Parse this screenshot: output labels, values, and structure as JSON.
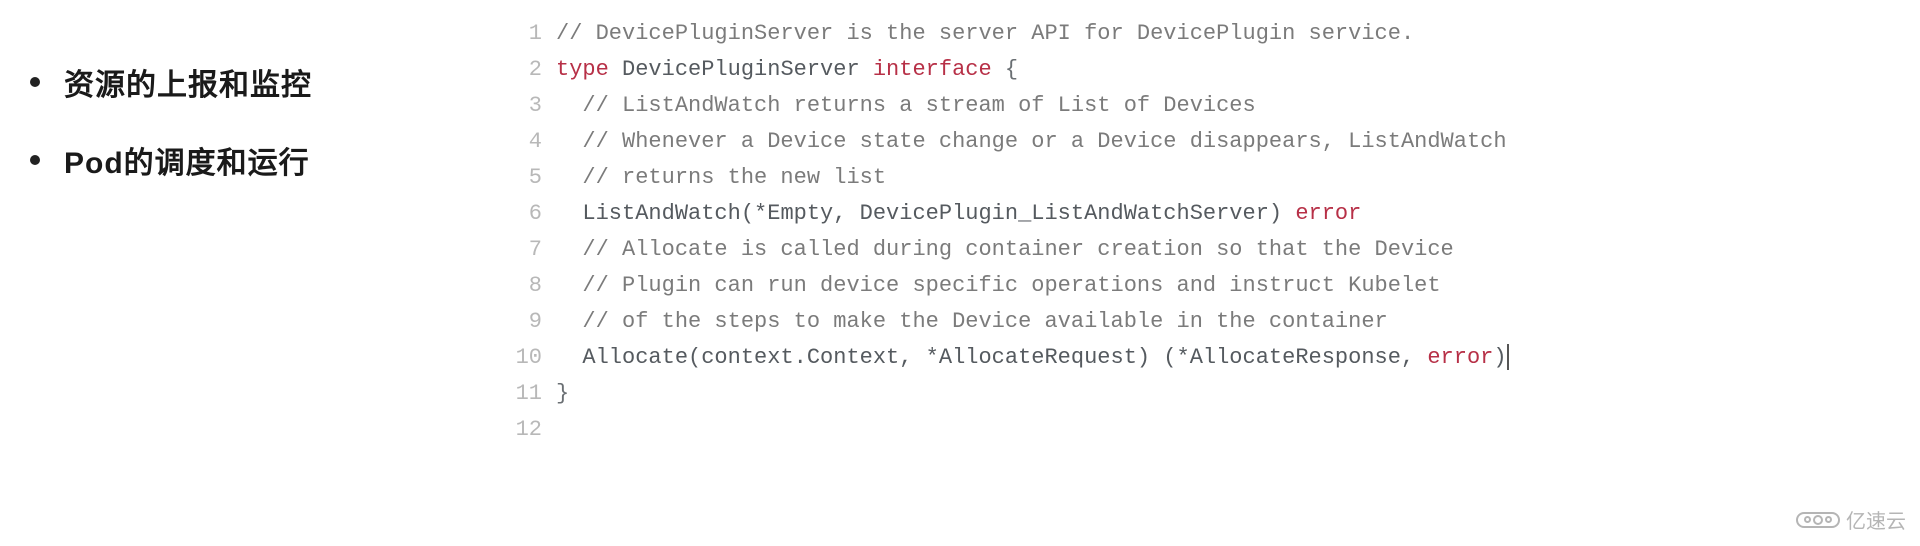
{
  "bullets": [
    "资源的上报和监控",
    "Pod的调度和运行"
  ],
  "code": {
    "lines": [
      {
        "n": 1,
        "segments": [
          {
            "t": "// DevicePluginServer is the server API for DevicePlugin service.",
            "c": "code"
          }
        ]
      },
      {
        "n": 2,
        "segments": [
          {
            "t": "type",
            "c": "tok-kw"
          },
          {
            "t": " ",
            "c": "code"
          },
          {
            "t": "DevicePluginServer",
            "c": "tok-id"
          },
          {
            "t": " ",
            "c": "code"
          },
          {
            "t": "interface",
            "c": "tok-kw"
          },
          {
            "t": " ",
            "c": "code"
          },
          {
            "t": "{",
            "c": "tok-punc"
          }
        ]
      },
      {
        "n": 3,
        "segments": [
          {
            "t": "  // ListAndWatch returns a stream of List of Devices",
            "c": "code"
          }
        ]
      },
      {
        "n": 4,
        "segments": [
          {
            "t": "  // Whenever a Device state change or a Device disappears, ListAndWatch",
            "c": "code"
          }
        ]
      },
      {
        "n": 5,
        "segments": [
          {
            "t": "  // returns the new list",
            "c": "code"
          }
        ]
      },
      {
        "n": 6,
        "segments": [
          {
            "t": "  ",
            "c": "code"
          },
          {
            "t": "ListAndWatch(*Empty, DevicePlugin_ListAndWatchServer)",
            "c": "tok-id"
          },
          {
            "t": " ",
            "c": "code"
          },
          {
            "t": "error",
            "c": "tok-err"
          }
        ]
      },
      {
        "n": 7,
        "segments": [
          {
            "t": "  // Allocate is called during container creation so that the Device",
            "c": "code"
          }
        ]
      },
      {
        "n": 8,
        "segments": [
          {
            "t": "  // Plugin can run device specific operations and instruct Kubelet",
            "c": "code"
          }
        ]
      },
      {
        "n": 9,
        "segments": [
          {
            "t": "  // of the steps to make the Device available in the container",
            "c": "code"
          }
        ]
      },
      {
        "n": 10,
        "segments": [
          {
            "t": "  ",
            "c": "code"
          },
          {
            "t": "Allocate(context.Context, *AllocateRequest) (*AllocateResponse,",
            "c": "tok-id"
          },
          {
            "t": " ",
            "c": "code"
          },
          {
            "t": "error",
            "c": "tok-err"
          },
          {
            "t": ")",
            "c": "tok-id"
          }
        ],
        "cursor": true
      },
      {
        "n": 11,
        "segments": [
          {
            "t": "}",
            "c": "tok-punc"
          }
        ]
      },
      {
        "n": 12,
        "segments": [
          {
            "t": "",
            "c": "code"
          }
        ]
      }
    ]
  },
  "watermark_text": "亿速云"
}
